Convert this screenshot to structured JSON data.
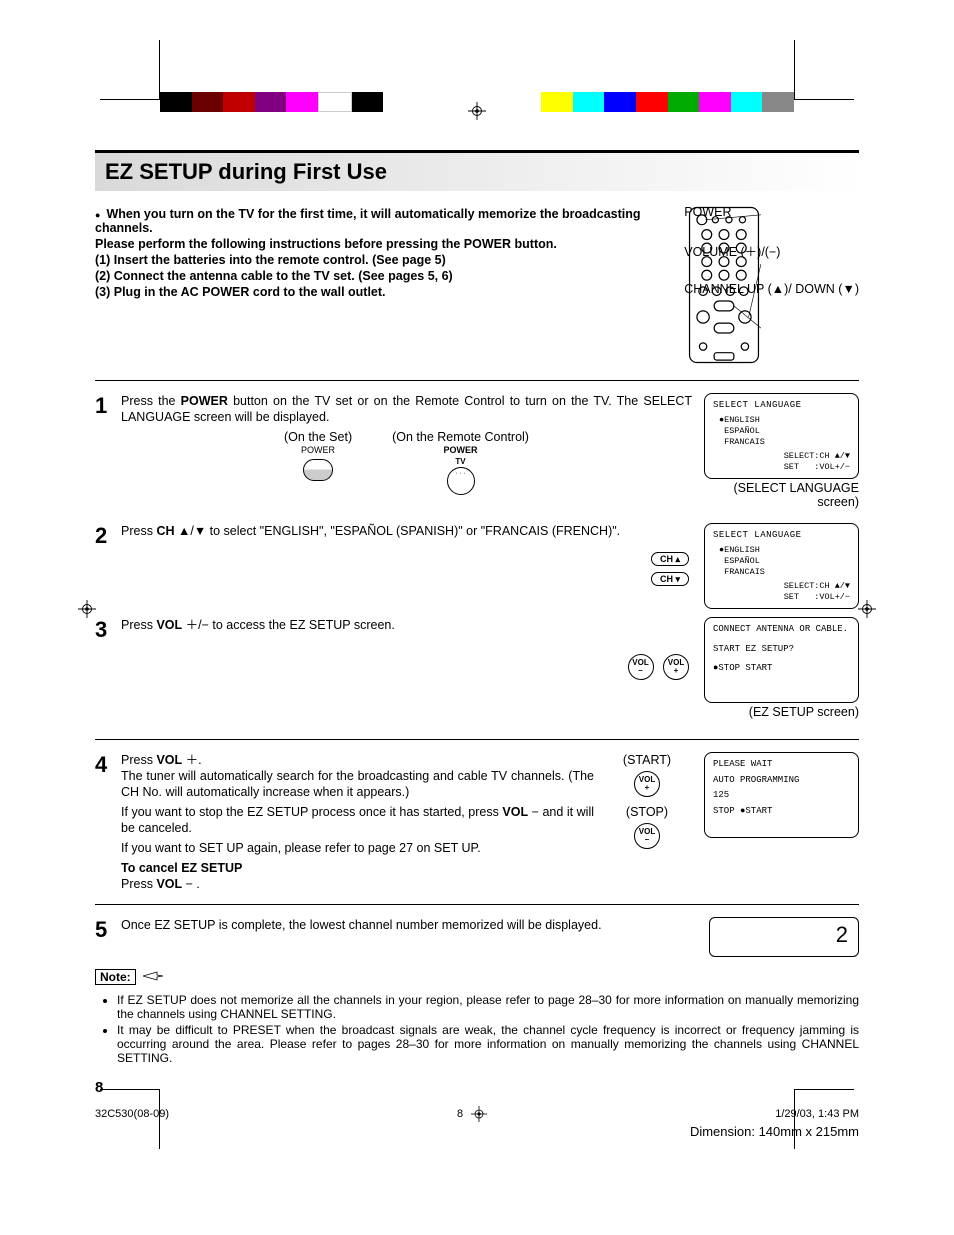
{
  "title": "EZ SETUP during First Use",
  "intro": {
    "lead": "When you turn on the TV for the first time, it will automatically memorize the broadcasting channels.",
    "p2": "Please perform the following instructions before pressing the POWER button.",
    "i1": "(1) Insert the batteries into the remote control. (See page 5)",
    "i2": "(2) Connect the antenna cable to the TV set.  (See pages 5, 6)",
    "i3": "(3) Plug in the AC POWER cord to the wall outlet."
  },
  "remote_labels": {
    "power": "POWER",
    "volume": "VOLUME (＋)/(−)",
    "channel": "CHANNEL UP (▲)/ DOWN (▼)"
  },
  "steps": {
    "s1": {
      "num": "1",
      "text_a": "Press the ",
      "text_power": "POWER",
      "text_b": " button on the TV set or on the Remote Control to turn on the TV. The SELECT LANGUAGE screen will be displayed.",
      "onset": "(On the Set)",
      "onremote": "(On the Remote Control)",
      "power_label": "POWER",
      "tv_label": "TV",
      "power_small": "POWER"
    },
    "s2": {
      "num": "2",
      "text_a": "Press ",
      "text_ch": "CH",
      "text_arrows": " ▲/▼ to select \"ENGLISH\", \"ESPAÑOL (SPANISH)\" or \"FRANCAIS (FRENCH)\".",
      "btn_up": "CH ▴",
      "btn_down": "CH ▾"
    },
    "s3": {
      "num": "3",
      "text_a": "Press ",
      "text_vol": "VOL",
      "text_b": " ＋/− to access the EZ SETUP screen.",
      "btn_minus_top": "VOL",
      "btn_minus_bot": "–",
      "btn_plus_top": "VOL",
      "btn_plus_bot": "+"
    },
    "s4": {
      "num": "4",
      "text_a": "Press ",
      "text_vol": "VOL",
      "text_b": " ＋.",
      "para1": "The tuner will automatically search for the broadcasting and cable TV channels. (The CH No. will automatically increase when it appears.)",
      "para2a": "If you want to stop the EZ SETUP process once it has started, press ",
      "para2vol": "VOL",
      "para2b": " − and it will be canceled.",
      "para3": "If you want to SET UP again, please refer to page 27 on SET UP.",
      "cancel_head": "To cancel EZ SETUP",
      "cancel_body_a": "Press ",
      "cancel_body_vol": "VOL",
      "cancel_body_b": " − .",
      "start": "(START)",
      "stop": "(STOP)",
      "btn_plus_top": "VOL",
      "btn_plus_bot": "+",
      "btn_minus_top": "VOL",
      "btn_minus_bot": "–"
    },
    "s5": {
      "num": "5",
      "text": "Once EZ SETUP is complete, the lowest channel number memorized will be displayed.",
      "display": "2"
    }
  },
  "screens": {
    "lang": {
      "title": "SELECT LANGUAGE",
      "items": "●ENGLISH\n ESPAÑOL\n FRANCAIS",
      "sel": "SELECT:CH ▲/▼\nSET   :VOL+/−",
      "caption": "(SELECT LANGUAGE screen)"
    },
    "lang2": {
      "title": "SELECT LANGUAGE",
      "items": "●ENGLISH\n ESPAÑOL\n FRANCAIS",
      "sel": "SELECT:CH ▲/▼\nSET   :VOL+/−"
    },
    "ez": {
      "line1": "CONNECT ANTENNA OR CABLE.",
      "line2": "START EZ SETUP?",
      "line3": "●STOP   START",
      "caption": "(EZ SETUP screen)"
    },
    "prog": {
      "line1": "PLEASE WAIT",
      "line2": "AUTO PROGRAMMING",
      "line3": "125",
      "line4": " STOP  ●START"
    }
  },
  "note": {
    "label": "Note:",
    "n1": "If EZ SETUP does not memorize all the channels in your region, please refer to page 28–30 for more information on manually memorizing the channels using CHANNEL SETTING.",
    "n2": "It may be difficult to PRESET when the broadcast signals are weak, the channel cycle frequency is incorrect or frequency jamming is occurring around the area. Please refer to pages 28–30 for more information on manually memorizing the channels using CHANNEL SETTING."
  },
  "page_number": "8",
  "footer": {
    "doc": "32C530(08-09)",
    "pg": "8",
    "ts": "1/29/03, 1:43 PM",
    "dim": "Dimension: 140mm x 215mm"
  },
  "colorbar": [
    "#000",
    "#800",
    "#f00",
    "#808",
    "#f0f",
    "#fff",
    "#000",
    "",
    "",
    "",
    "",
    "",
    "#ff0",
    "#0ff",
    "#00f",
    "#f00",
    "#0a0",
    "#f0f",
    "#0ff",
    "#888"
  ]
}
